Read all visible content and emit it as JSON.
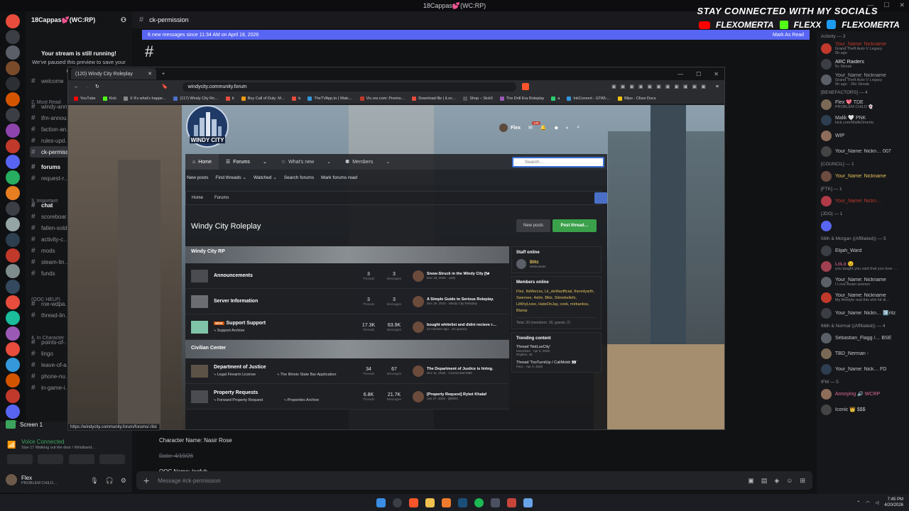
{
  "window": {
    "title": "18Cappas💕(WC:RP)"
  },
  "social": {
    "headline": "STAY CONNECTED WITH MY SOCIALS",
    "handles": [
      "FLEXOMERTA",
      "FLEXX",
      "FLEXOMERTA"
    ]
  },
  "discord": {
    "server": "18Cappas💕(WC:RP)",
    "channel": "ck-permission",
    "newmsg": "6 new messages since 11:34 AM on April 18, 2026",
    "mark_read": "Mark As Read",
    "stream_title": "Your stream is still running!",
    "stream_sub": "We've paused this preview to save your resources.",
    "categories": [
      {
        "label": "2. Must Read"
      },
      {
        "label": "3. Important"
      },
      {
        "label": "(OOC HELP)"
      },
      {
        "label": "4. In Character"
      }
    ],
    "channels": [
      "welcome",
      "windy-ann…",
      "ifm-annou…",
      "faction-an…",
      "rules-upd…",
      "ck-permiss…",
      "forums",
      "request-r…",
      "chat",
      "scoreboar…",
      "fallen-sold…",
      "activity-c…",
      "mods",
      "steam-lin…",
      "funds",
      "roe-wdpa…",
      "thread-lin…",
      "points-of-…",
      "lingo",
      "leave-of-a…",
      "phone-nu…",
      "in-game-i…"
    ],
    "screen": "Screen 1",
    "voice": "Voice Connected",
    "voice_sub": "Size 17 Walking out the door / Wristband…",
    "user": "Flex",
    "user_status": "PROBLEM CHILD…",
    "chat": [
      "Character Name: Nasir Rose",
      "Date: 4/19/26",
      "OOC Name: leefuh"
    ],
    "input_placeholder": "Message #ck-permission"
  },
  "browser": {
    "tab": "(120) Windy City Roleplay",
    "url": "windycity.community.forum",
    "bookmarks": [
      "YouTube",
      "Kick",
      "X It's what's happe…",
      "(117) Windy City Ro…",
      "b",
      "Buy Call of Duty: M…",
      "b",
      "TheTVApp.to | Watc…",
      "Vic.rez.com: Premiu…",
      "Download file | iLov…",
      "Shop – Sick0",
      "The Drill Era Roleplay",
      "a",
      "InkConvert - GTA5-…",
      "Blips - Cfure Docs"
    ],
    "status_url": "https://windycity.community.forum/forums/-/list"
  },
  "forum": {
    "user": "Flex",
    "badge": "120",
    "nav": [
      "Home",
      "Forums",
      "What's new",
      "Members"
    ],
    "search": "Search…",
    "subnav": [
      "New posts",
      "Find threads",
      "Watched",
      "Search forums",
      "Mark forums read"
    ],
    "crumbs": [
      "Home",
      "Forums"
    ],
    "title": "Windy City Roleplay",
    "new_posts": "New posts",
    "post_thread": "Post thread…",
    "cat1": "Windy City RP",
    "cat2": "Civilian Center",
    "nodes": [
      {
        "title": "Announcements",
        "threads": "3",
        "messages": "3",
        "last": "Snow-Struck in the Windy City 🌬",
        "meta": "Dec 18, 2025 · carly"
      },
      {
        "title": "Server Information",
        "threads": "3",
        "messages": "3",
        "last": "A Simple Guide to Serious Roleplay.",
        "meta": "Dec 28, 2022 · Windy City Roleplay"
      },
      {
        "title": "Support Support",
        "tag": "NEW",
        "sub": "Support Archive",
        "threads": "17.3K",
        "messages": "63.9K",
        "last": "bought whitelist and didnt recieve r…",
        "meta": "24 minutes ago · oG.quanny"
      },
      {
        "title": "Department of Justice",
        "sub": "Legal Firearm License",
        "sub2": "The Illinois State Bar Application",
        "threads": "34",
        "messages": "67",
        "last": "The Department of Justice is hiring.",
        "meta": "Dec 11, 2025 · CosmicStar1989"
      },
      {
        "title": "Property Requests",
        "sub": "Forward Property Request",
        "sub2": "Properties Archive",
        "threads": "6.8K",
        "messages": "21.7K",
        "last": "[Property Request] Ryleé Khalaf",
        "meta": "Jan 27, 2026 · jllBill32"
      }
    ],
    "threads_label": "Threads",
    "messages_label": "Messages",
    "staff_head": "Staff online",
    "staff": "Blitz",
    "staff_role": "Webmaster",
    "members_head": "Members online",
    "members_online": "Flex, ItsMercxs, Lil_skrillaofficial, theonlyarth, Swervee, 4slim, Blitz, Slimebeliefs, LilKhyLivee, HateOnJay, cook, mirbankss, Blamp",
    "total": "Total: 20 (members: 18, guests: 2)",
    "trending_head": "Trending content",
    "trending": [
      {
        "title": "Thread 'NotLuvCity'",
        "meta": "Kwembee · Apr 9, 2026",
        "replies": "Replies: 40"
      },
      {
        "title": "Thread 'TooTurntUp / CaliMobb 👀'",
        "meta": "Pacc · Apr 9, 2026"
      }
    ]
  },
  "member_list": [
    {
      "cat": "Activity — 3"
    },
    {
      "name": "Your_Name: Nickname",
      "sub": "Grand Theft Auto V Legacy",
      "sub2": "5h ago",
      "color": "#c0392b"
    },
    {
      "name": "ARC Raiders",
      "sub": "5x Streak",
      "color": "#e6e7ea"
    },
    {
      "name": "Your_Name: Nickname",
      "sub": "Grand Theft Auto V Legacy",
      "sub2": "5h ago · 34x Streak",
      "color": "#9aa0a6"
    },
    {
      "cat": "[BENEFACTORS] — 4"
    },
    {
      "name": "Flex 💖 TDE",
      "sub": "PROBLEM CHILD 👻",
      "color": "#c4c7cc"
    },
    {
      "name": "Malik 🤍 PNK",
      "sub": "kick.com/MalikOmerta",
      "color": "#c4c7cc"
    },
    {
      "name": "WIP",
      "color": "#c4c7cc"
    },
    {
      "name": "Your_Name: Nickn… 007",
      "color": "#c4c7cc"
    },
    {
      "cat": "[COUNCIL] — 1"
    },
    {
      "name": "Your_Name: Nickname",
      "color": "#e3c25c"
    },
    {
      "cat": "[FTK] — 1"
    },
    {
      "name": "Your_Name: Nickn…",
      "color": "#c0392b"
    },
    {
      "cat": "[JDG] — 1"
    },
    {
      "name": "",
      "color": "#c4c7cc"
    },
    {
      "cat": "56th & Morgan ((Affiliated)) — 5"
    },
    {
      "name": "Elijah_Ward",
      "color": "#c4c7cc"
    },
    {
      "name": "LoLo 😉",
      "sub": "you taught you said that you love …",
      "color": "#e06c9f"
    },
    {
      "name": "Your_Name: Nickname",
      "sub": "I Love Asian women",
      "color": "#c4c7cc"
    },
    {
      "name": "Your_Name: Nickname",
      "sub": "My lifestyle real this shit hit di…",
      "color": "#c4c7cc"
    },
    {
      "name": "Your_Name: Nickn… 3️⃣ritz",
      "color": "#c4c7cc"
    },
    {
      "cat": "66th & Normal ((Affiliated)) — 4"
    },
    {
      "name": "Sebastian_Flagg /… BSE",
      "color": "#c4c7cc"
    },
    {
      "name": "TBD_Nerman -",
      "color": "#c4c7cc"
    },
    {
      "name": "Your_Name: Nick… FD",
      "color": "#c4c7cc"
    },
    {
      "cat": "IFM — 5"
    },
    {
      "name": "Annoying 🔊 WCRP",
      "color": "#e06c9f"
    },
    {
      "name": "Iconic 👑 $$$",
      "color": "#c4c7cc"
    }
  ],
  "taskbar": {
    "time": "7:45 PM",
    "date": "4/20/2026"
  }
}
